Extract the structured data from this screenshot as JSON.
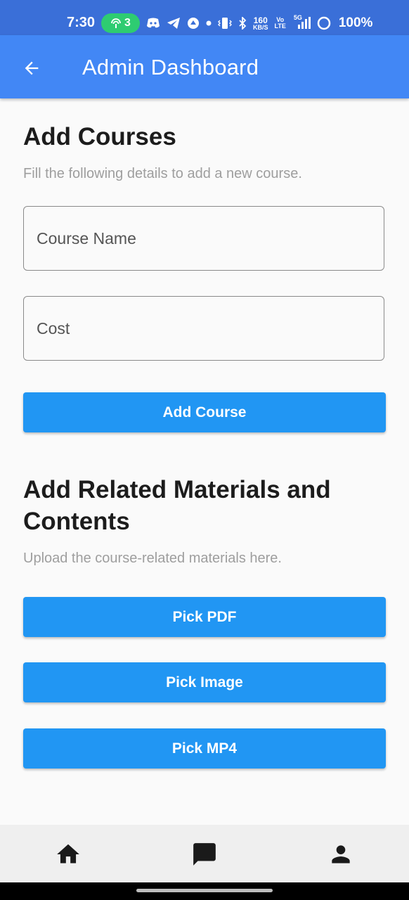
{
  "status_bar": {
    "time": "7:30",
    "hotspot_count": "3",
    "net_speed_value": "160",
    "net_speed_unit": "KB/S",
    "volte_top": "Vo",
    "volte_bottom": "LTE",
    "network_type": "5G",
    "battery": "100%"
  },
  "app_bar": {
    "title": "Admin Dashboard"
  },
  "add_courses": {
    "title": "Add Courses",
    "subtitle": "Fill the following details to add a new course.",
    "course_name_placeholder": "Course Name",
    "cost_placeholder": "Cost",
    "submit_label": "Add Course"
  },
  "materials": {
    "title_line1": "Add Related Materials and",
    "title_line2": "Contents",
    "subtitle": "Upload the course-related materials here.",
    "pick_pdf_label": "Pick PDF",
    "pick_image_label": "Pick Image",
    "pick_mp4_label": "Pick MP4"
  },
  "bottom_nav": {
    "items": [
      {
        "icon": "home-icon"
      },
      {
        "icon": "chat-icon"
      },
      {
        "icon": "person-icon"
      }
    ]
  },
  "colors": {
    "app_bar": "#4287f5",
    "status_bar": "#3a6fd8",
    "button": "#2196f3",
    "hotspot_pill": "#2ecc71"
  }
}
